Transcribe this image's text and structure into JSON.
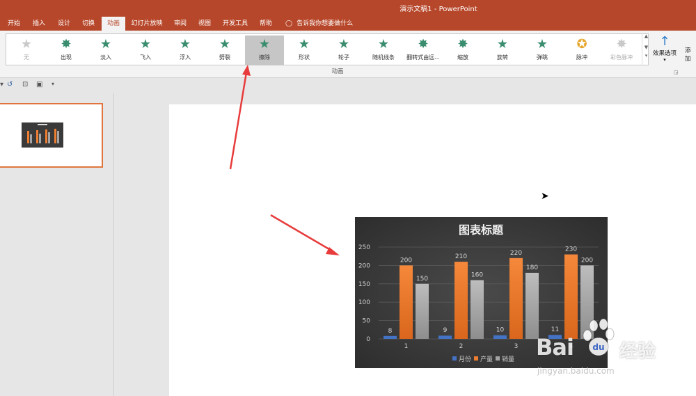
{
  "titlebar": {
    "title": "演示文稿1  -  PowerPoint"
  },
  "tabs": [
    "开始",
    "插入",
    "设计",
    "切换",
    "动画",
    "幻灯片放映",
    "审阅",
    "视图",
    "开发工具",
    "帮助"
  ],
  "active_tab": "动画",
  "tell_me": "告诉我你想要做什么",
  "animations": [
    {
      "label": "无",
      "state": "none"
    },
    {
      "label": "出现",
      "state": "normal"
    },
    {
      "label": "淡入",
      "state": "normal"
    },
    {
      "label": "飞入",
      "state": "normal"
    },
    {
      "label": "浮入",
      "state": "normal"
    },
    {
      "label": "劈裂",
      "state": "normal"
    },
    {
      "label": "擦除",
      "state": "selected"
    },
    {
      "label": "形状",
      "state": "normal"
    },
    {
      "label": "轮子",
      "state": "normal"
    },
    {
      "label": "随机线条",
      "state": "normal"
    },
    {
      "label": "翻转式由远...",
      "state": "normal"
    },
    {
      "label": "缩放",
      "state": "normal"
    },
    {
      "label": "旋转",
      "state": "normal"
    },
    {
      "label": "弹跳",
      "state": "normal"
    },
    {
      "label": "脉冲",
      "state": "pulse"
    },
    {
      "label": "彩色脉冲",
      "state": "disabled"
    }
  ],
  "effect_options": "效果选项",
  "add_animation": "添加",
  "group_label": "动画",
  "chart_data": {
    "type": "bar",
    "title": "图表标题",
    "categories": [
      "1",
      "2",
      "3",
      "4"
    ],
    "series": [
      {
        "name": "月份",
        "values": [
          8,
          9,
          10,
          11
        ],
        "color": "#4472c4"
      },
      {
        "name": "产量",
        "values": [
          200,
          210,
          220,
          230
        ],
        "color": "#ed7d31"
      },
      {
        "name": "销量",
        "values": [
          150,
          160,
          180,
          200
        ],
        "color": "#a5a5a5"
      }
    ],
    "yticks": [
      "0",
      "50",
      "100",
      "150",
      "200",
      "250"
    ],
    "ylim": [
      0,
      250
    ],
    "grid": true,
    "legend": "bottom"
  },
  "watermark": {
    "brand": "Bai",
    "brand2": "经验",
    "url": "jingyan.baidu.com"
  }
}
